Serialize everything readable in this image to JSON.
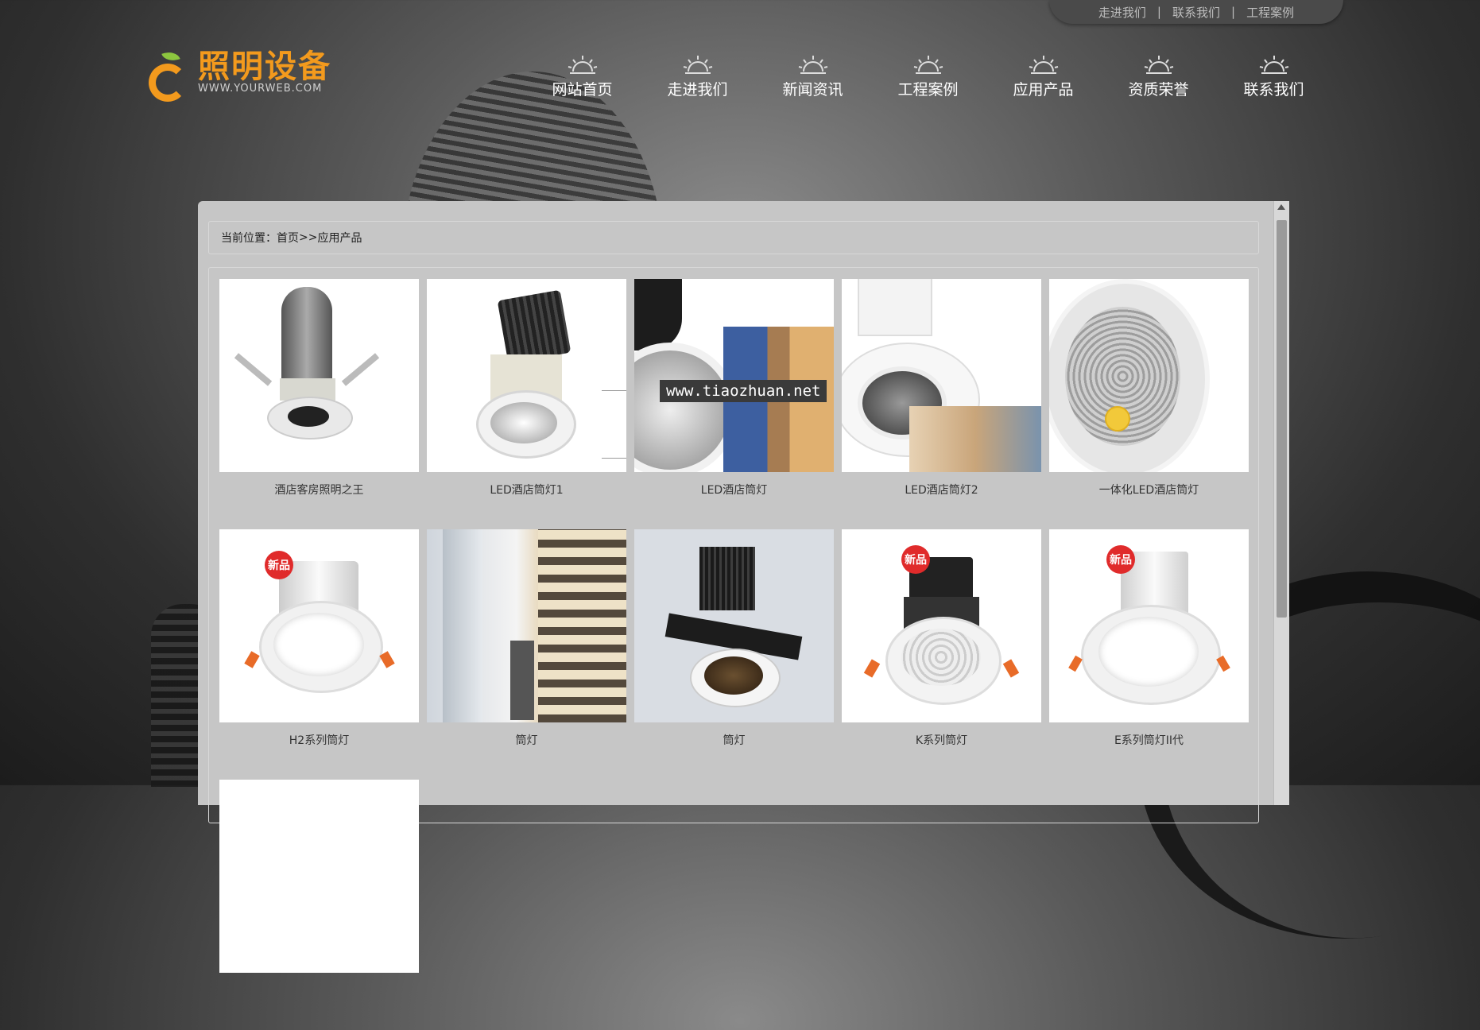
{
  "top_links": [
    "走进我们",
    "联系我们",
    "工程案例"
  ],
  "top_links_separator": "|",
  "logo": {
    "title": "照明设备",
    "url": "WWW.YOURWEB.COM"
  },
  "nav": [
    {
      "label": "网站首页",
      "icon": "sun-icon"
    },
    {
      "label": "走进我们",
      "icon": "sun-icon"
    },
    {
      "label": "新闻资讯",
      "icon": "sun-icon"
    },
    {
      "label": "工程案例",
      "icon": "sun-icon"
    },
    {
      "label": "应用产品",
      "icon": "sun-icon"
    },
    {
      "label": "资质荣誉",
      "icon": "sun-icon"
    },
    {
      "label": "联系我们",
      "icon": "sun-icon"
    }
  ],
  "breadcrumb": {
    "prefix": "当前位置：",
    "home": "首页",
    "sep": ">>",
    "current": "应用产品"
  },
  "products": [
    {
      "name": "酒店客房照明之王"
    },
    {
      "name": "LED酒店筒灯1"
    },
    {
      "name": "LED酒店筒灯"
    },
    {
      "name": "LED酒店筒灯2"
    },
    {
      "name": "一体化LED酒店筒灯"
    },
    {
      "name": "H2系列筒灯",
      "badge": "新品"
    },
    {
      "name": "筒灯"
    },
    {
      "name": "筒灯"
    },
    {
      "name": "K系列筒灯",
      "badge": "新品"
    },
    {
      "name": "E系列筒灯II代",
      "badge": "新品"
    }
  ],
  "watermark": "www.tiaozhuan.net",
  "colors": {
    "brand_orange": "#f39a1d",
    "leaf_green": "#8cc63f",
    "badge_red": "#e02b2b",
    "panel": "#c6c6c6"
  }
}
